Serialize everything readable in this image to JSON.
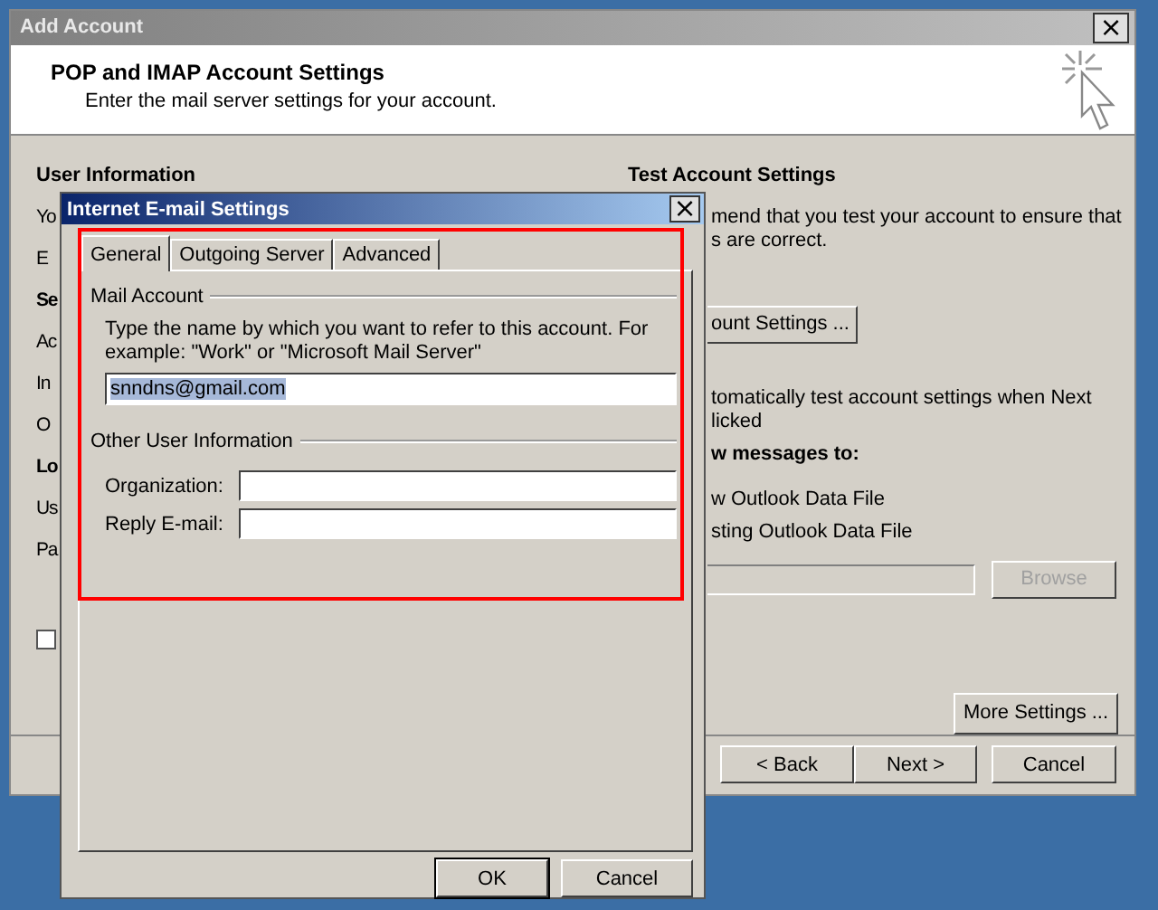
{
  "background_window": {
    "title": "Add Account",
    "header_title": "POP and IMAP Account Settings",
    "header_subtitle": "Enter the mail server settings for your account.",
    "left_items": [
      {
        "text": "User Information",
        "bold": true
      },
      {
        "text": "Yo",
        "bold": false
      },
      {
        "text": "E",
        "bold": false
      },
      {
        "text": "Se",
        "bold": true
      },
      {
        "text": "Ac",
        "bold": false
      },
      {
        "text": "In",
        "bold": false
      },
      {
        "text": "O",
        "bold": false
      },
      {
        "text": "Lo",
        "bold": true
      },
      {
        "text": "Us",
        "bold": false
      },
      {
        "text": "Pa",
        "bold": false
      }
    ],
    "left_checkbox": {
      "checked": false
    },
    "right_items": [
      {
        "kind": "heading",
        "text": "Test Account Settings"
      },
      {
        "kind": "text",
        "text": "mend that you test your account to ensure that"
      },
      {
        "kind": "text",
        "text": "s are correct."
      },
      {
        "kind": "button",
        "text": "ount Settings ..."
      },
      {
        "kind": "text",
        "text": "tomatically test account settings when Next"
      },
      {
        "kind": "text",
        "text": "licked"
      },
      {
        "kind": "bold",
        "text": "w messages to:"
      },
      {
        "kind": "text",
        "text": "w Outlook Data File"
      },
      {
        "kind": "text",
        "text": "sting Outlook Data File"
      },
      {
        "kind": "browse",
        "text": "Browse",
        "disabled": true
      },
      {
        "kind": "more",
        "text": "More Settings ..."
      }
    ],
    "buttons": [
      {
        "label": "< Back"
      },
      {
        "label": "Next >"
      },
      {
        "label": "Cancel"
      }
    ]
  },
  "dialog": {
    "title": "Internet E-mail Settings",
    "close": "×",
    "tabs": [
      {
        "label": "General",
        "selected": true
      },
      {
        "label": "Outgoing Server",
        "selected": false
      },
      {
        "label": "Advanced",
        "selected": false
      }
    ],
    "mail_account": {
      "legend": "Mail Account",
      "description": "Type the name by which you want to refer to this account. For example: \"Work\" or \"Microsoft Mail Server\"",
      "value": "snndns@gmail.com",
      "highlighted": true
    },
    "other_info": {
      "legend": "Other User Information",
      "fields": [
        {
          "label": "Organization:"
        },
        {
          "label": "Reply E-mail:"
        }
      ]
    },
    "buttons": [
      {
        "label": "OK",
        "default": true
      },
      {
        "label": "Cancel",
        "default": false
      }
    ]
  }
}
